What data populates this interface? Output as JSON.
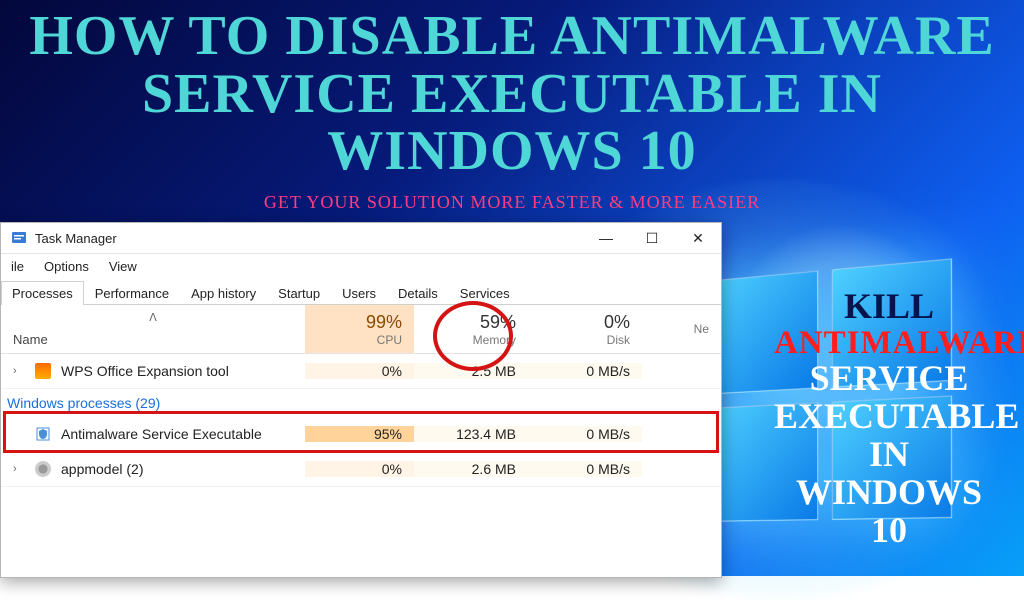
{
  "headline": "HOW TO DISABLE ANTIMALWARE SERVICE EXECUTABLE IN WINDOWS 10",
  "tagline": "GET YOUR SOLUTION MORE FASTER & MORE EASIER",
  "side": {
    "l1": "KILL",
    "l2": "ANTIMALWARE",
    "l3": "SERVICE EXECUTABLE IN WINDOWS 10"
  },
  "tm": {
    "title": "Task Manager",
    "menu": [
      "ile",
      "Options",
      "View"
    ],
    "tabs": [
      "Processes",
      "Performance",
      "App history",
      "Startup",
      "Users",
      "Details",
      "Services"
    ],
    "active_tab": 0,
    "columns": {
      "name": "Name",
      "sort_glyph": "ᐱ",
      "cpu": {
        "value": "99%",
        "label": "CPU"
      },
      "mem": {
        "value": "59%",
        "label": "Memory"
      },
      "disk": {
        "value": "0%",
        "label": "Disk"
      },
      "net": {
        "value": "",
        "label": "Ne"
      }
    },
    "rows": [
      {
        "kind": "app",
        "expand": "›",
        "icon": "wps",
        "name": "WPS Office Expansion tool",
        "cpu": "0%",
        "cpu_heavy": false,
        "mem": "2.5 MB",
        "disk": "0 MB/s"
      },
      {
        "kind": "group",
        "label": "Windows processes (29)"
      },
      {
        "kind": "app",
        "expand": "",
        "icon": "shield",
        "name": "Antimalware Service Executable",
        "cpu": "95%",
        "cpu_heavy": true,
        "mem": "123.4 MB",
        "disk": "0 MB/s",
        "highlight": true
      },
      {
        "kind": "app",
        "expand": "›",
        "icon": "gear",
        "name": "appmodel (2)",
        "cpu": "0%",
        "cpu_heavy": false,
        "mem": "2.6 MB",
        "disk": "0 MB/s"
      }
    ]
  },
  "annotations": {
    "cpu_circle": true,
    "row_box": true
  }
}
